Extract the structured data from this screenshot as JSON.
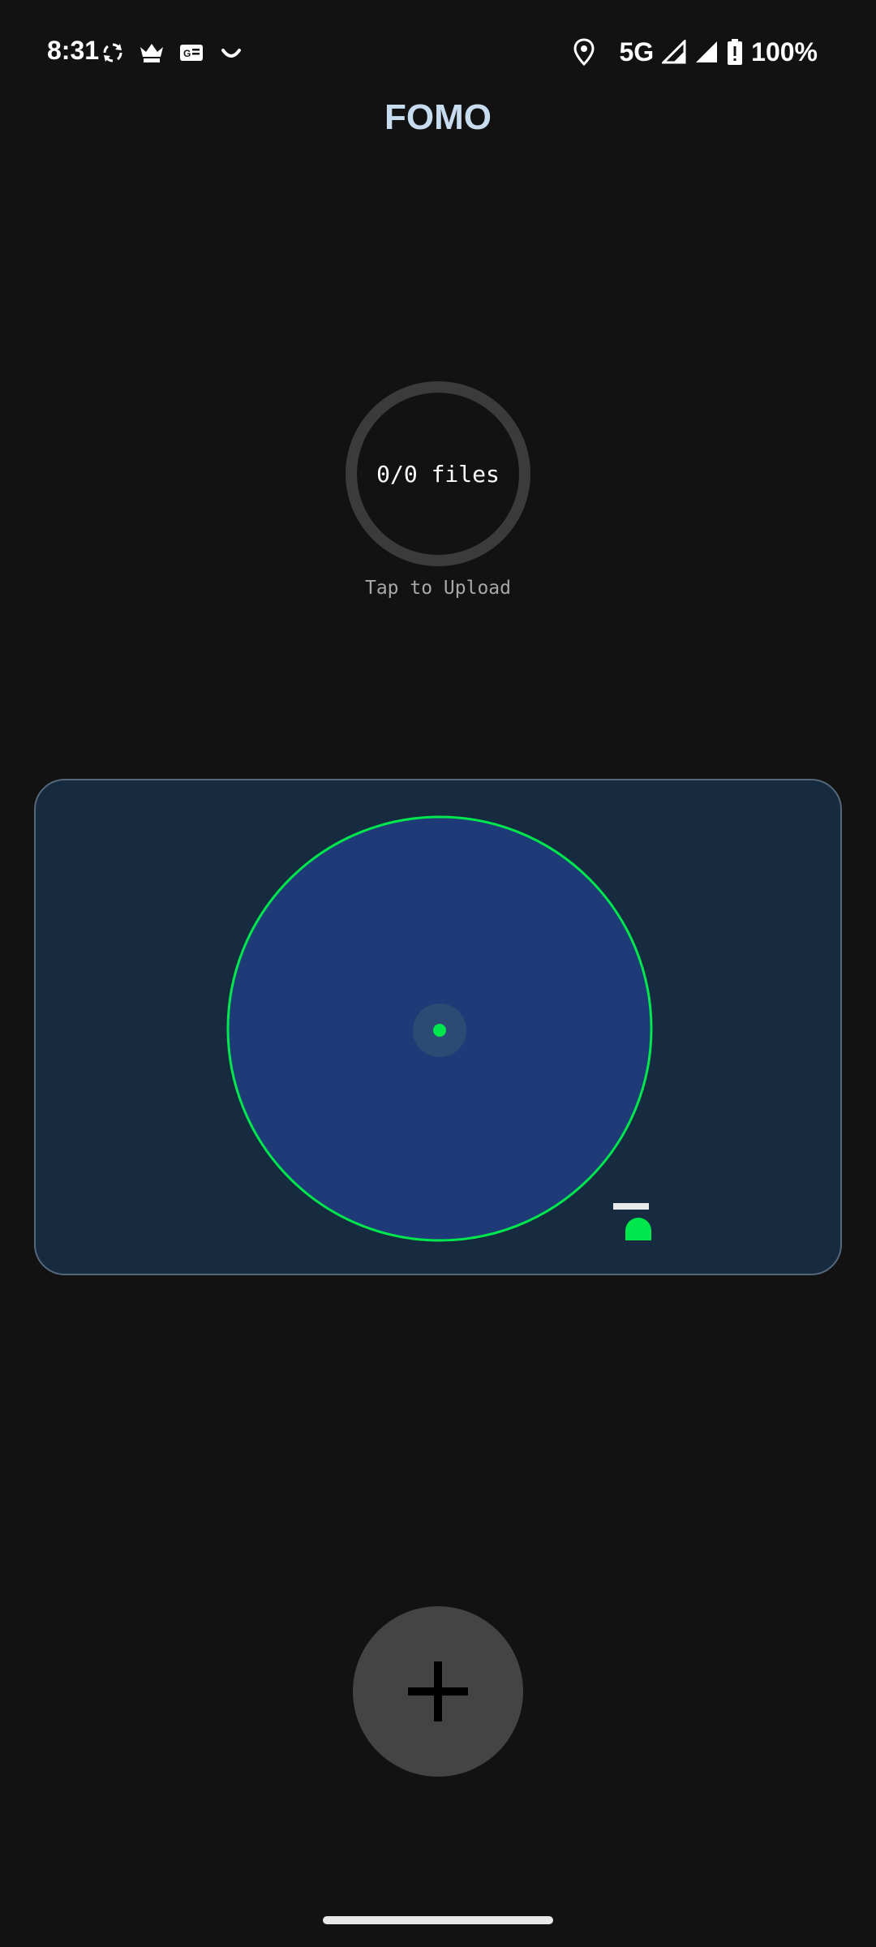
{
  "status_bar": {
    "time": "8:31",
    "network": "5G",
    "battery": "100%",
    "icons": [
      "sync-icon",
      "jester-app-icon",
      "news-icon",
      "smile-icon",
      "location-icon",
      "signal-icon",
      "signal-full-icon",
      "battery-alert-icon"
    ]
  },
  "app": {
    "title": "FOMO"
  },
  "upload": {
    "count": "0/0 files",
    "hint": "Tap to Upload"
  },
  "map": {
    "range_color": "#00e64d",
    "range_fill": "#1f3b77",
    "background": "#172b40"
  },
  "fab": {
    "icon": "plus-icon"
  }
}
